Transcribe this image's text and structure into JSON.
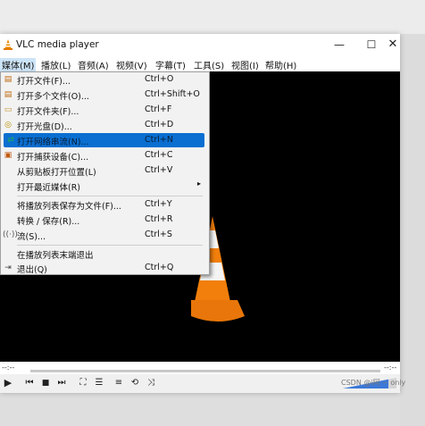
{
  "window": {
    "title": "VLC media player",
    "minimize_glyph": "—",
    "maximize_glyph": "☐",
    "close_glyph": "✕",
    "app_icon": "vlc-cone-icon"
  },
  "menubar": [
    {
      "label": "媒体(M)",
      "active": true
    },
    {
      "label": "播放(L)"
    },
    {
      "label": "音频(A)"
    },
    {
      "label": "视频(V)"
    },
    {
      "label": "字幕(T)"
    },
    {
      "label": "工具(S)"
    },
    {
      "label": "视图(I)"
    },
    {
      "label": "帮助(H)"
    }
  ],
  "media_menu": {
    "items": [
      {
        "label": "打开文件(F)...",
        "shortcut": "Ctrl+O",
        "icon": "open-file-icon"
      },
      {
        "label": "打开多个文件(O)...",
        "shortcut": "Ctrl+Shift+O",
        "icon": "open-multiple-files-icon"
      },
      {
        "label": "打开文件夹(F)...",
        "shortcut": "Ctrl+F",
        "icon": "open-folder-icon"
      },
      {
        "label": "打开光盘(D)...",
        "shortcut": "Ctrl+D",
        "icon": "disc-icon"
      },
      {
        "label": "打开网络串流(N)...",
        "shortcut": "Ctrl+N",
        "icon": "network-icon",
        "highlighted": true
      },
      {
        "label": "打开捕获设备(C)...",
        "shortcut": "Ctrl+C",
        "icon": "capture-device-icon"
      },
      {
        "label": "从剪贴板打开位置(L)",
        "shortcut": "Ctrl+V",
        "icon": ""
      },
      {
        "label": "打开最近媒体(R)",
        "shortcut": "",
        "icon": "",
        "submenu": true
      },
      {
        "label": "将播放列表保存为文件(F)...",
        "shortcut": "Ctrl+Y",
        "icon": ""
      },
      {
        "label": "转换 / 保存(R)...",
        "shortcut": "Ctrl+R",
        "icon": ""
      },
      {
        "label": "流(S)...",
        "shortcut": "Ctrl+S",
        "icon": "stream-icon"
      },
      {
        "label": "在播放列表末端退出",
        "shortcut": "",
        "icon": ""
      },
      {
        "label": "退出(Q)",
        "shortcut": "Ctrl+Q",
        "icon": "exit-icon"
      }
    ]
  },
  "seek": {
    "elapsed": "--:--",
    "total": "--:--",
    "progress": 0
  },
  "volume": {
    "level": 0.85
  },
  "watermark": "CSDN @i阿 ~ only"
}
